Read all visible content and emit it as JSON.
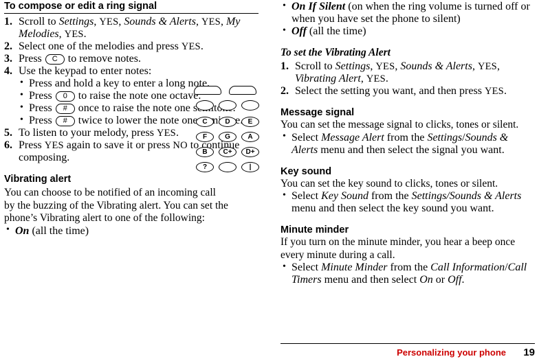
{
  "left": {
    "heading": "To compose or edit a ring signal",
    "steps": [
      {
        "num": "1.",
        "parts": [
          {
            "t": "Scroll to ",
            "s": "plain"
          },
          {
            "t": "Settings",
            "s": "italic"
          },
          {
            "t": ", ",
            "s": "plain"
          },
          {
            "t": "YES",
            "s": "smallcaps"
          },
          {
            "t": ", ",
            "s": "plain"
          },
          {
            "t": "Sounds & Alerts",
            "s": "italic"
          },
          {
            "t": ", ",
            "s": "plain"
          },
          {
            "t": "YES",
            "s": "smallcaps"
          },
          {
            "t": ", ",
            "s": "plain"
          },
          {
            "t": "My Melodies",
            "s": "italic"
          },
          {
            "t": ", ",
            "s": "plain"
          },
          {
            "t": "YES",
            "s": "smallcaps"
          },
          {
            "t": ".",
            "s": "plain"
          }
        ]
      },
      {
        "num": "2.",
        "parts": [
          {
            "t": "Select one of the melodies and press ",
            "s": "plain"
          },
          {
            "t": "YES",
            "s": "smallcaps"
          },
          {
            "t": ".",
            "s": "plain"
          }
        ]
      },
      {
        "num": "3.",
        "parts": [
          {
            "t": "Press ",
            "s": "plain"
          },
          {
            "t": "C",
            "s": "keycap"
          },
          {
            "t": " to remove notes.",
            "s": "plain"
          }
        ]
      },
      {
        "num": "4.",
        "parts": [
          {
            "t": "Use the keypad to enter notes:",
            "s": "plain"
          }
        ]
      }
    ],
    "substeps": [
      {
        "parts": [
          {
            "t": "Press and hold a key to enter a long note.",
            "s": "plain"
          }
        ]
      },
      {
        "parts": [
          {
            "t": "Press ",
            "s": "plain"
          },
          {
            "t": "0",
            "s": "keycap"
          },
          {
            "t": " to raise the note one octave.",
            "s": "plain"
          }
        ]
      },
      {
        "parts": [
          {
            "t": "Press ",
            "s": "plain"
          },
          {
            "t": "#",
            "s": "keycap"
          },
          {
            "t": " once to raise the note one semitone.",
            "s": "plain"
          }
        ]
      },
      {
        "parts": [
          {
            "t": "Press ",
            "s": "plain"
          },
          {
            "t": "#",
            "s": "keycap"
          },
          {
            "t": " twice to lower the note one semitone.",
            "s": "plain"
          }
        ]
      }
    ],
    "steps_after": [
      {
        "num": "5.",
        "parts": [
          {
            "t": "To listen to your melody, press ",
            "s": "plain"
          },
          {
            "t": "YES",
            "s": "smallcaps"
          },
          {
            "t": ".",
            "s": "plain"
          }
        ]
      },
      {
        "num": "6.",
        "parts": [
          {
            "t": "Press ",
            "s": "plain"
          },
          {
            "t": "YES",
            "s": "smallcaps"
          },
          {
            "t": " again to save it or press ",
            "s": "plain"
          },
          {
            "t": "NO",
            "s": "smallcaps"
          },
          {
            "t": " to continue composing.",
            "s": "plain"
          }
        ]
      }
    ],
    "vibrating": {
      "heading": "Vibrating alert",
      "body_lines": [
        "You can choose to be notified of an incoming call",
        "by the buzzing of the Vibrating alert. You can set the",
        "phone’s Vibrating alert to one of the following:"
      ],
      "bullets": [
        {
          "parts": [
            {
              "t": "On",
              "s": "bold-italic"
            },
            {
              "t": " (all the time)",
              "s": "plain"
            }
          ]
        }
      ]
    },
    "keypad": {
      "label": "phone-keypad-diagram",
      "softkeys": [
        "left-softkey",
        "right-softkey"
      ],
      "ovals": [
        "up-key",
        "select-key",
        "down-key"
      ],
      "keys": [
        [
          "C",
          "D",
          "E"
        ],
        [
          "F",
          "G",
          "A"
        ],
        [
          "B",
          "C+",
          "D+"
        ],
        [
          "?",
          "",
          "|"
        ]
      ]
    }
  },
  "right": {
    "top_bullets": [
      {
        "parts": [
          {
            "t": "On If Silent",
            "s": "bold-italic"
          },
          {
            "t": " (on when the ring volume is turned off or when you have set the phone to silent)",
            "s": "plain"
          }
        ]
      },
      {
        "parts": [
          {
            "t": "Off",
            "s": "bold-italic"
          },
          {
            "t": " (all the time)",
            "s": "plain"
          }
        ]
      }
    ],
    "vibrating_alert": {
      "heading": "To set the Vibrating Alert",
      "steps": [
        {
          "num": "1.",
          "parts": [
            {
              "t": "Scroll to ",
              "s": "plain"
            },
            {
              "t": "Settings",
              "s": "italic"
            },
            {
              "t": ", ",
              "s": "plain"
            },
            {
              "t": "YES",
              "s": "smallcaps"
            },
            {
              "t": ", ",
              "s": "plain"
            },
            {
              "t": "Sounds & Alerts",
              "s": "italic"
            },
            {
              "t": ", ",
              "s": "plain"
            },
            {
              "t": "YES",
              "s": "smallcaps"
            },
            {
              "t": ", ",
              "s": "plain"
            },
            {
              "t": "Vibrating Alert",
              "s": "italic"
            },
            {
              "t": ", ",
              "s": "plain"
            },
            {
              "t": "YES",
              "s": "smallcaps"
            },
            {
              "t": ".",
              "s": "plain"
            }
          ]
        },
        {
          "num": "2.",
          "parts": [
            {
              "t": "Select the setting you want, and then press ",
              "s": "plain"
            },
            {
              "t": "YES",
              "s": "smallcaps"
            },
            {
              "t": ".",
              "s": "plain"
            }
          ]
        }
      ]
    },
    "message_signal": {
      "heading": "Message signal",
      "body": "You can set the message signal to clicks, tones or silent.",
      "bullets": [
        {
          "parts": [
            {
              "t": "Select ",
              "s": "plain"
            },
            {
              "t": "Message Alert",
              "s": "italic"
            },
            {
              "t": " from the ",
              "s": "plain"
            },
            {
              "t": "Settings",
              "s": "italic"
            },
            {
              "t": "/",
              "s": "plain"
            },
            {
              "t": "Sounds & Alerts",
              "s": "italic"
            },
            {
              "t": " menu and then select the signal you want.",
              "s": "plain"
            }
          ]
        }
      ]
    },
    "key_sound": {
      "heading": "Key sound",
      "body": "You can set the key sound to clicks, tones or silent.",
      "bullets": [
        {
          "parts": [
            {
              "t": "Select ",
              "s": "plain"
            },
            {
              "t": "Key Sound",
              "s": "italic"
            },
            {
              "t": " from the ",
              "s": "plain"
            },
            {
              "t": "Settings/Sounds & Alerts",
              "s": "italic"
            },
            {
              "t": " menu and then select the key sound you want.",
              "s": "plain"
            }
          ]
        }
      ]
    },
    "minute_minder": {
      "heading": "Minute minder",
      "body": "If you turn on the minute minder, you hear a beep once every minute during a call.",
      "bullets": [
        {
          "parts": [
            {
              "t": "Select ",
              "s": "plain"
            },
            {
              "t": "Minute Minder",
              "s": "italic"
            },
            {
              "t": " from the ",
              "s": "plain"
            },
            {
              "t": "Call Information",
              "s": "italic"
            },
            {
              "t": "/",
              "s": "plain"
            },
            {
              "t": "Call Timers",
              "s": "italic"
            },
            {
              "t": " menu and then select ",
              "s": "plain"
            },
            {
              "t": "On",
              "s": "italic"
            },
            {
              "t": " or ",
              "s": "plain"
            },
            {
              "t": "Off",
              "s": "italic"
            },
            {
              "t": ".",
              "s": "plain"
            }
          ]
        }
      ]
    }
  },
  "footer": {
    "chapter": "Personalizing your phone",
    "page_number": "19",
    "chapter_color": "#cc0000"
  }
}
